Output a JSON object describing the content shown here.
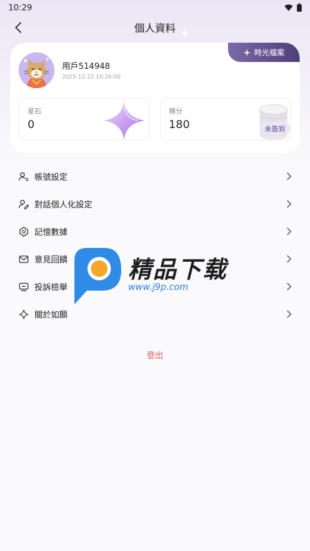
{
  "status": {
    "time": "10:29"
  },
  "header": {
    "title": "個人資料"
  },
  "profile": {
    "archive_label": "時光檔案",
    "username": "用戶514948",
    "timestamp": "2025-12-22 10:26:00"
  },
  "stats": {
    "stones": {
      "label": "星石",
      "value": "0"
    },
    "points": {
      "label": "積分",
      "value": "180",
      "badge": "未簽到"
    }
  },
  "menu": {
    "items": [
      {
        "label": "帳號設定",
        "icon": "user-settings-icon"
      },
      {
        "label": "對話個人化設定",
        "icon": "user-edit-icon"
      },
      {
        "label": "記憶數據",
        "icon": "brain-icon"
      },
      {
        "label": "意見回饋",
        "icon": "mail-icon"
      },
      {
        "label": "投訴檢舉",
        "icon": "report-icon"
      },
      {
        "label": "關於如願",
        "icon": "sparkle-icon"
      }
    ]
  },
  "logout_label": "登出",
  "watermark": {
    "title": "精品下载",
    "url": "www.j9p.com"
  },
  "colors": {
    "accent": "#5a4a8a",
    "logout": "#e05a5a",
    "badge_gradient_start": "#7a6aa8",
    "badge_gradient_end": "#4d3f7a"
  }
}
